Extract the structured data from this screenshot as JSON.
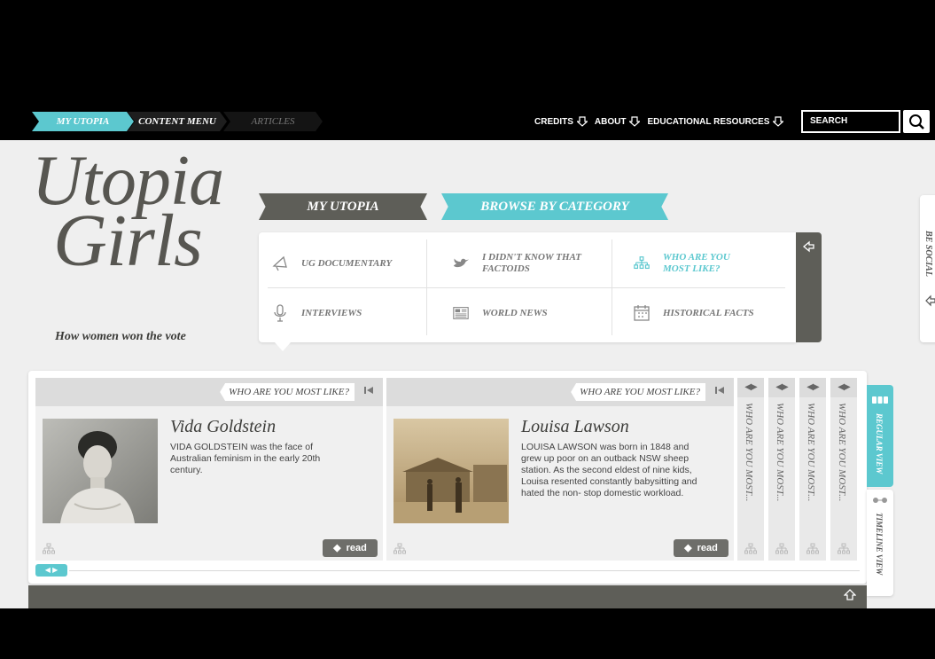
{
  "nav": {
    "tabs": [
      "MY UTOPIA",
      "CONTENT MENU",
      "ARTICLES"
    ],
    "links": [
      "CREDITS",
      "ABOUT",
      "EDUCATIONAL RESOURCES"
    ],
    "search_placeholder": "SEARCH"
  },
  "logo": {
    "line1": "Utopia",
    "line2": "Girls",
    "tagline": "How women won the vote"
  },
  "ribbons": {
    "my_utopia": "MY UTOPIA",
    "browse": "BROWSE BY CATEGORY"
  },
  "categories": [
    {
      "label": "UG DOCUMENTARY",
      "icon": "megaphone-icon"
    },
    {
      "label": "I DIDN'T KNOW THAT FACTOIDS",
      "icon": "bird-icon"
    },
    {
      "label": "WHO ARE YOU MOST LIKE?",
      "icon": "tree-icon"
    },
    {
      "label": "INTERVIEWS",
      "icon": "microphone-icon"
    },
    {
      "label": "WORLD NEWS",
      "icon": "newspaper-icon"
    },
    {
      "label": "HISTORICAL FACTS",
      "icon": "calendar-icon"
    }
  ],
  "social_label": "BE SOCIAL",
  "cards": [
    {
      "tag": "WHO ARE YOU MOST LIKE?",
      "name": "Vida Goldstein",
      "desc": "VIDA GOLDSTEIN was the face of Australian feminism in the early 20th century.",
      "read": "read"
    },
    {
      "tag": "WHO ARE YOU MOST LIKE?",
      "name": "Louisa Lawson",
      "desc": "LOUISA LAWSON was born in 1848 and grew up poor on an outback NSW sheep station. As the second eldest of nine kids, Louisa resented constantly babysitting and hated the non- stop domestic workload.",
      "read": "read"
    }
  ],
  "narrow_label": "WHO ARE YOU MOST...",
  "views": {
    "regular": "REGULAR VIEW",
    "timeline": "TIMELINE VIEW"
  },
  "colors": {
    "accent": "#5cc8cf",
    "dark": "#5e5e58"
  }
}
